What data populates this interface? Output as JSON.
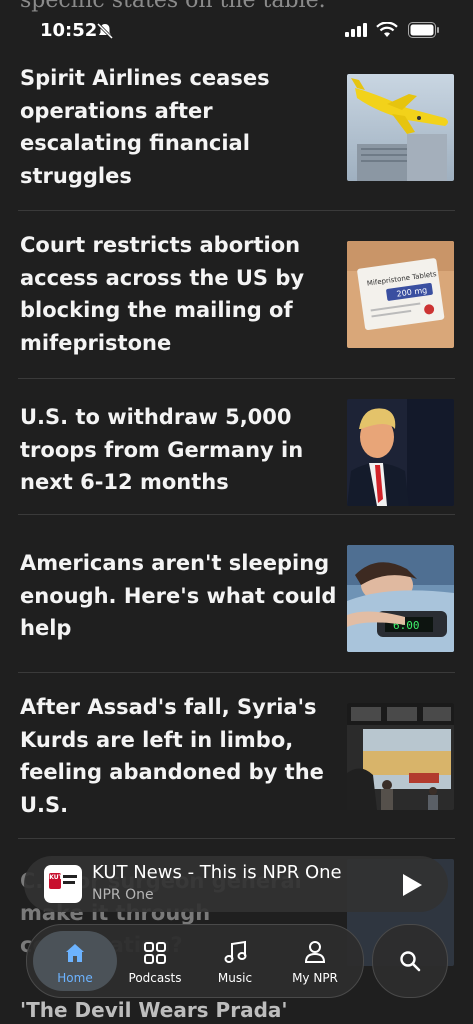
{
  "status_bar": {
    "time": "10:52"
  },
  "behind_text": "specific states on the table.",
  "stories": [
    {
      "headline": "Spirit Airlines ceases operations after escalating financial struggles",
      "image": "yellow-airplane-photo"
    },
    {
      "headline": "Court restricts abortion access across the US by blocking the mailing of mifepristone",
      "image": "mifepristone-box-photo",
      "image_text": "Mifepristone Tablets",
      "image_dose": "200 mg"
    },
    {
      "headline": "U.S. to withdraw 5,000 troops from Germany in next 6-12 months",
      "image": "president-portrait-photo"
    },
    {
      "headline": "Americans aren't sleeping enough. Here's what could help",
      "image": "alarm-clock-photo",
      "image_text": "6:00"
    },
    {
      "headline": "After Assad's fall, Syria's Kurds are left in limbo, feeling abandoned by the U.S.",
      "image": "syria-street-photo"
    },
    {
      "headline": "C... for surgeon general make it through confirmation?",
      "image": "partial-photo"
    }
  ],
  "bottom_partial": "'The Devil Wears Prada'",
  "player": {
    "title": "KUT News - This is NPR One",
    "subtitle": "NPR One",
    "logo_text": "KUT"
  },
  "tabs": [
    {
      "label": "Home",
      "icon": "home-icon",
      "active": true
    },
    {
      "label": "Podcasts",
      "icon": "grid-icon",
      "active": false
    },
    {
      "label": "Music",
      "icon": "music-note-icon",
      "active": false
    },
    {
      "label": "My NPR",
      "icon": "person-icon",
      "active": false
    }
  ],
  "colors": {
    "background": "#1f1f1f",
    "active_tab": "#6cb3ff"
  }
}
